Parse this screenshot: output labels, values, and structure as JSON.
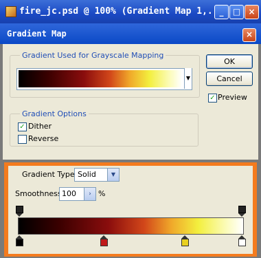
{
  "document": {
    "title": "fire_jc.psd @ 100% (Gradient Map 1,..."
  },
  "dialog": {
    "title": "Gradient Map",
    "gradient_group_label": "Gradient Used for Grayscale Mapping",
    "options_group_label": "Gradient Options",
    "dither_label": "Dither",
    "dither_checked": true,
    "reverse_label": "Reverse",
    "reverse_checked": false,
    "ok_label": "OK",
    "cancel_label": "Cancel",
    "preview_label": "Preview",
    "preview_checked": true
  },
  "editor": {
    "gradient_type_label": "Gradient Type:",
    "gradient_type_value": "Solid",
    "smoothness_label": "Smoothness:",
    "smoothness_value": "100",
    "smoothness_unit": "%",
    "color_stop_colors": [
      "#000000",
      "#c01a1a",
      "#e8d020",
      "#ffffff"
    ]
  },
  "colors": {
    "accent_orange": "#f47b1e",
    "xp_title_blue": "#0a49c6"
  }
}
